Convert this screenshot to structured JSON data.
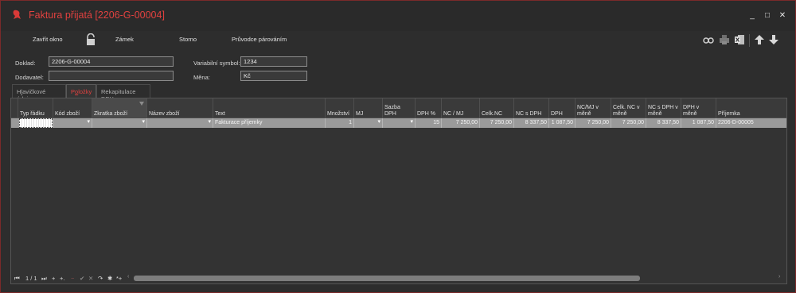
{
  "window": {
    "title": "Faktura přijatá [2206-G-00004]",
    "accent": "#e0413f",
    "minimize": "_",
    "maximize": "□",
    "close": "✕"
  },
  "toolbar": {
    "close_window": "Zavřít okno",
    "lock": "Zámek",
    "cancel": "Storno",
    "pairing_wizard": "Průvodce párováním",
    "icons": [
      "binoculars-icon",
      "printer-icon",
      "excel-icon",
      "arrow-up-icon",
      "arrow-down-icon"
    ]
  },
  "form": {
    "doklad_label": "Doklad:",
    "doklad_value": "2206-G-00004",
    "dodavatel_label": "Dodavatel:",
    "dodavatel_value": "",
    "variabilni_label": "Variabilní symbol:",
    "variabilni_value": "1234",
    "mena_label": "Měna:",
    "mena_value": "Kč"
  },
  "tabs": [
    {
      "label_pre": "H",
      "label_ul": "l",
      "label_post": "avičkové údaje"
    },
    {
      "label_pre": "P",
      "label_ul": "o",
      "label_post": "ložky"
    },
    {
      "label_pre": "Rekapitulace ",
      "label_ul": "D",
      "label_post": "PH"
    }
  ],
  "grid": {
    "columns": [
      "Typ řádku",
      "Kód zboží",
      "Zkratka zboží",
      "Název zboží",
      "Text",
      "Množství",
      "MJ",
      "Sazba DPH",
      "DPH %",
      "NC / MJ",
      "Celk.NC",
      "NC s DPH",
      "DPH",
      "NC/MJ v měně",
      "Celk. NC v měně",
      "NC s DPH v měně",
      "DPH v měně",
      "Příjemka"
    ],
    "row": {
      "typ": "",
      "kod": "",
      "zkratka": "",
      "nazev": "",
      "text": "Fakturace příjemky",
      "mnozstvi": "1",
      "mj": "",
      "sazba": "",
      "dph_pct": "15",
      "nc_mj": "7 250,00",
      "celk_nc": "7 250,00",
      "nc_s_dph": "8 337,50",
      "dph": "1 087,50",
      "nc_mj_mena": "7 250,00",
      "celk_nc_mena": "7 250,00",
      "nc_s_dph_mena": "8 337,50",
      "dph_mena": "1 087,50",
      "prijemka": "2206-D-00005"
    },
    "row_marker": "›"
  },
  "navigator": {
    "first": "⏮",
    "page": "1 / 1",
    "last": "⏭",
    "add": "+",
    "insert": "+.",
    "delete": "−",
    "post": "✔",
    "cancel": "✕",
    "refresh": "↷",
    "mark": "✱",
    "filter": "*+",
    "scroll_left": "‹",
    "scroll_right": "›"
  }
}
